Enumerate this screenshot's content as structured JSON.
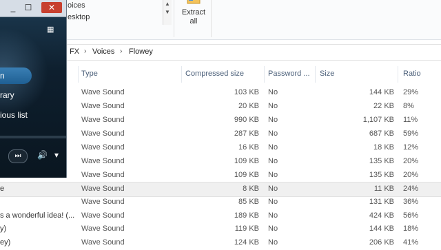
{
  "ribbon": {
    "items": [
      "oices",
      "esktop"
    ],
    "extract_label_1": "Extract",
    "extract_label_2": "all"
  },
  "address": {
    "crumbs": [
      "FX",
      "Voices",
      "Flowey"
    ]
  },
  "columns": [
    "Type",
    "Compressed size",
    "Password ...",
    "Size",
    "Ratio"
  ],
  "rows": [
    {
      "name": "",
      "type": "Wave Sound",
      "compressed": "103 KB",
      "password": "No",
      "size": "144 KB",
      "ratio": "29%"
    },
    {
      "name": "",
      "type": "Wave Sound",
      "compressed": "20 KB",
      "password": "No",
      "size": "22 KB",
      "ratio": "8%"
    },
    {
      "name": "",
      "type": "Wave Sound",
      "compressed": "990 KB",
      "password": "No",
      "size": "1,107 KB",
      "ratio": "11%"
    },
    {
      "name": "",
      "type": "Wave Sound",
      "compressed": "287 KB",
      "password": "No",
      "size": "687 KB",
      "ratio": "59%"
    },
    {
      "name": "",
      "type": "Wave Sound",
      "compressed": "16 KB",
      "password": "No",
      "size": "18 KB",
      "ratio": "12%"
    },
    {
      "name": "",
      "type": "Wave Sound",
      "compressed": "109 KB",
      "password": "No",
      "size": "135 KB",
      "ratio": "20%"
    },
    {
      "name": "",
      "type": "Wave Sound",
      "compressed": "109 KB",
      "password": "No",
      "size": "135 KB",
      "ratio": "20%"
    },
    {
      "name": "e",
      "type": "Wave Sound",
      "compressed": "8 KB",
      "password": "No",
      "size": "11 KB",
      "ratio": "24%"
    },
    {
      "name": "",
      "type": "Wave Sound",
      "compressed": "85 KB",
      "password": "No",
      "size": "131 KB",
      "ratio": "36%"
    },
    {
      "name": "s a wonderful idea! (...",
      "type": "Wave Sound",
      "compressed": "189 KB",
      "password": "No",
      "size": "424 KB",
      "ratio": "56%"
    },
    {
      "name": "y)",
      "type": "Wave Sound",
      "compressed": "119 KB",
      "password": "No",
      "size": "144 KB",
      "ratio": "18%"
    },
    {
      "name": "ey)",
      "type": "Wave Sound",
      "compressed": "124 KB",
      "password": "No",
      "size": "206 KB",
      "ratio": "41%"
    }
  ],
  "player": {
    "minimize": "_",
    "maximize": "☐",
    "close": "✕",
    "menu_items": [
      "n",
      "rary",
      "ious list"
    ],
    "next": "⏭",
    "volume": "🔊",
    "menu_arrow": "▾"
  }
}
